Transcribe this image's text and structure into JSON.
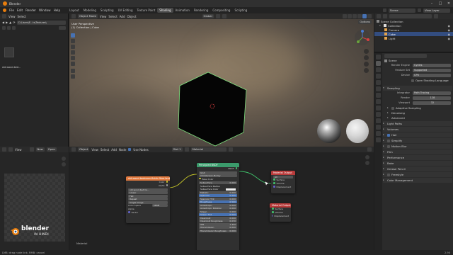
{
  "title_bar": {
    "app_title": "Blender"
  },
  "menu": {
    "items": [
      "File",
      "Edit",
      "Render",
      "Window",
      "Help"
    ]
  },
  "workspaces": {
    "tabs": [
      "Layout",
      "Modeling",
      "Sculpting",
      "UV Editing",
      "Texture Paint",
      "Shading",
      "Animation",
      "Rendering",
      "Compositing",
      "Scripting"
    ],
    "active": "Shading"
  },
  "top_right": {
    "scene": "Scene",
    "view_layer": "View Layer"
  },
  "file_browser": {
    "menu": [
      "View",
      "Select"
    ],
    "path": "C:\\Users\\E...ts\\Textures\\",
    "thumb_label": "old-wood-bed..."
  },
  "viewport": {
    "mode": "Object Mode",
    "menu": [
      "View",
      "Select",
      "Add",
      "Object"
    ],
    "orientation": "Global",
    "options": "Options",
    "info_line1": "User Perspective",
    "info_line2": "(1) Collection | Cube"
  },
  "node_editor": {
    "type": "Object",
    "menu": [
      "View",
      "Select",
      "Add",
      "Node"
    ],
    "use_nodes": "Use Nodes",
    "slot": "Slot 1",
    "material": "Material",
    "footer_label": "Material",
    "image_node": {
      "title": "old-wood-bedroom-finish-fibre-texture",
      "outputs": [
        "Color",
        "Alpha"
      ],
      "image_name": "old-wood-bedroo...",
      "interp": "Linear",
      "proj": "Flat",
      "ext": "Repeat",
      "source": "Single Image",
      "cs_label": "Color Space",
      "cs_value": "sRGB",
      "alpha_label": "Alpha",
      "vector": "Vector"
    },
    "bsdf_node": {
      "title": "Principled BSDF",
      "output": "BSDF",
      "dist": "GGX",
      "sss": "Christensen-Burley",
      "rows": [
        {
          "label": "Base Color",
          "value": ""
        },
        {
          "label": "Subsurface",
          "value": "0.000"
        },
        {
          "label": "Subsurface Radius",
          "value": ""
        },
        {
          "label": "Subsurface Color",
          "value": ""
        },
        {
          "label": "Metallic",
          "value": "0.000"
        },
        {
          "label": "Specular",
          "value": "0.500"
        },
        {
          "label": "Specular Tint",
          "value": "0.000"
        },
        {
          "label": "Roughness",
          "value": "0.500"
        },
        {
          "label": "Anisotropic",
          "value": "0.000"
        },
        {
          "label": "Anisotropic Rotation",
          "value": "0.000"
        },
        {
          "label": "Sheen",
          "value": "0.000"
        },
        {
          "label": "Sheen Tint",
          "value": "0.500"
        },
        {
          "label": "Clearcoat",
          "value": "0.000"
        },
        {
          "label": "Clearcoat Roughness",
          "value": "0.030"
        },
        {
          "label": "IOR",
          "value": "1.450"
        },
        {
          "label": "Transmission",
          "value": "0.000"
        },
        {
          "label": "Transmission Roughness",
          "value": "0.000"
        }
      ]
    },
    "output_node1": {
      "title": "Material Output",
      "target": "All",
      "inputs": [
        "Surface",
        "Volume",
        "Displacement"
      ]
    },
    "output_node2": {
      "title": "Material Output",
      "inputs": [
        "Surface",
        "Volume",
        "Displacement"
      ]
    }
  },
  "image_editor": {
    "menu": [
      "View"
    ],
    "new": "New",
    "open": "Open"
  },
  "watermark": {
    "line1": "blender",
    "line2": "IN HINDI"
  },
  "outliner": {
    "title": "Scene Collection",
    "items": [
      {
        "label": "Collection"
      },
      {
        "label": "Camera"
      },
      {
        "label": "Cube"
      },
      {
        "label": "Light"
      }
    ]
  },
  "properties": {
    "scene": "Scene",
    "render_engine_label": "Render Engine",
    "render_engine": "Cycles",
    "feature_set_label": "Feature Set",
    "feature_set": "Supported",
    "device_label": "Device",
    "device": "CPU",
    "osl": "Open Shading Language",
    "sampling": "Sampling",
    "integrator_label": "Integrator",
    "integrator": "Path Tracing",
    "render_label": "Render",
    "render_samples": "128",
    "viewport_label": "Viewport",
    "viewport_samples": "32",
    "adaptive": "Adaptive Sampling",
    "denoising": "Denoising",
    "advanced": "Advanced",
    "panels": [
      "Light Paths",
      "Volumes",
      "Hair",
      "Simplify",
      "Motion Blur",
      "Film",
      "Performance",
      "Bake",
      "Grease Pencil",
      "Freestyle",
      "Color Management"
    ]
  },
  "status": {
    "left": "LMB: drag node link, RMB: cancel",
    "version": "2.90"
  },
  "colors": {
    "accent_blue": "#4772b3",
    "node_image": "#e27a3f",
    "node_shader": "#3b9b6c",
    "node_output": "#b93b3b"
  }
}
